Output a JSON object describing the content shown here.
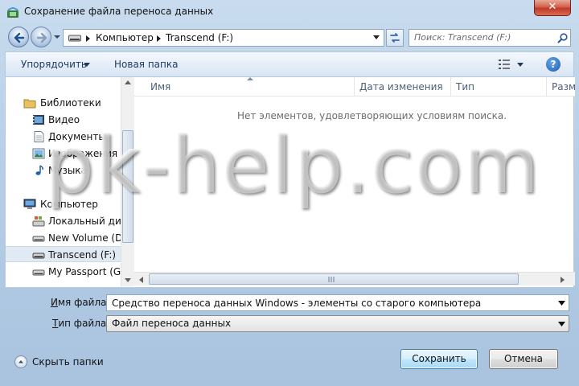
{
  "window": {
    "title": "Сохранение файла переноса данных",
    "close_label": "✕"
  },
  "address": {
    "crumbs": [
      "Компьютер",
      "Transcend (F:)"
    ]
  },
  "search": {
    "placeholder": "Поиск: Transcend (F:)"
  },
  "toolbar": {
    "organize_label": "Упорядочить",
    "new_folder_label": "Новая папка",
    "help_label": "?"
  },
  "nav": {
    "libraries_label": "Библиотеки",
    "library_items": [
      "Видео",
      "Документы",
      "Изображения",
      "Музыка"
    ],
    "computer_label": "Компьютер",
    "drives": [
      "Локальный диск",
      "New Volume (D:)",
      "Transcend (F:)",
      "My Passport (G:)"
    ],
    "selected": "Transcend (F:)"
  },
  "columns": [
    "Имя",
    "Дата изменения",
    "Тип",
    "Разм"
  ],
  "empty_message": "Нет элементов, удовлетворяющих условиям поиска.",
  "watermark": "pk-help.com",
  "form": {
    "filename_label_u": "И",
    "filename_label_rest": "мя файла:",
    "filename_value": "Средство переноса данных Windows - элементы со старого компьютера",
    "filetype_label_u": "Т",
    "filetype_label_rest": "ип файла:",
    "filetype_value": "Файл переноса данных"
  },
  "footer": {
    "hide_folders_label": "Скрыть папки",
    "save_label": "Сохранить",
    "cancel_label": "Отмена"
  },
  "colors": {
    "accent": "#3c7fb1",
    "close": "#c0392b"
  }
}
